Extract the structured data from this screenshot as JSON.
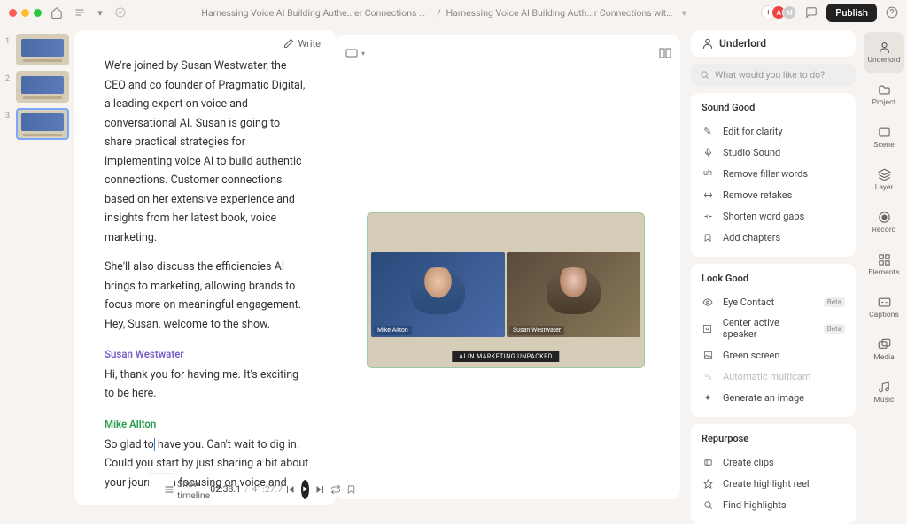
{
  "topbar": {
    "breadcrumb1": "Harnessing Voice AI Building Authe...er Connections with Susan Westwater",
    "breadcrumb2": "Harnessing Voice AI Building Auth...r Connections with Susan Westwater",
    "publish": "Publish",
    "avatar1": "A",
    "avatar2": "M"
  },
  "scenes": [
    {
      "num": "1"
    },
    {
      "num": "2"
    },
    {
      "num": "3"
    }
  ],
  "transcript": {
    "write": "Write",
    "p1": "We're joined by Susan Westwater, the CEO and co founder of Pragmatic Digital, a leading expert on voice and conversational AI. Susan is going to share practical strategies for implementing voice AI to build authentic connections. Customer connections based on her extensive experience and insights from her latest book, voice marketing.",
    "p2": "She'll also discuss the efficiencies AI brings to marketing, allowing brands to focus more on meaningful engagement. Hey, Susan, welcome to the show.",
    "speaker_susan": "Susan Westwater",
    "p3": "Hi, thank you for having me. It's exciting to be here.",
    "speaker_mike": "Mike Allton",
    "p4a": "So glad to",
    "p4b": " have you. Can't wait to dig in. Could you start by just sharing a bit about your journey in focusing on voice and"
  },
  "preview": {
    "name1": "Mike Allton",
    "name2": "Susan Westwater",
    "caption": "AI IN MARKETING UNPACKED"
  },
  "underlord": {
    "title": "Underlord",
    "search_placeholder": "What would you like to do?"
  },
  "sections": {
    "sound_good": {
      "title": "Sound Good",
      "items": [
        "Edit for clarity",
        "Studio Sound",
        "Remove filler words",
        "Remove retakes",
        "Shorten word gaps",
        "Add chapters"
      ]
    },
    "look_good": {
      "title": "Look Good",
      "eye_contact": "Eye Contact",
      "center_speaker": "Center active speaker",
      "green_screen": "Green screen",
      "auto_multicam": "Automatic multicam",
      "gen_image": "Generate an image",
      "beta": "Beta"
    },
    "repurpose": {
      "title": "Repurpose",
      "items": [
        "Create clips",
        "Create highlight reel",
        "Find highlights"
      ]
    }
  },
  "rail": {
    "underlord": "Underlord",
    "project": "Project",
    "scene": "Scene",
    "layer": "Layer",
    "record": "Record",
    "elements": "Elements",
    "captions": "Captions",
    "media": "Media",
    "music": "Music"
  },
  "bottom": {
    "show_timeline": "Show timeline",
    "current": "02:38.1",
    "total": "41:27.7"
  }
}
